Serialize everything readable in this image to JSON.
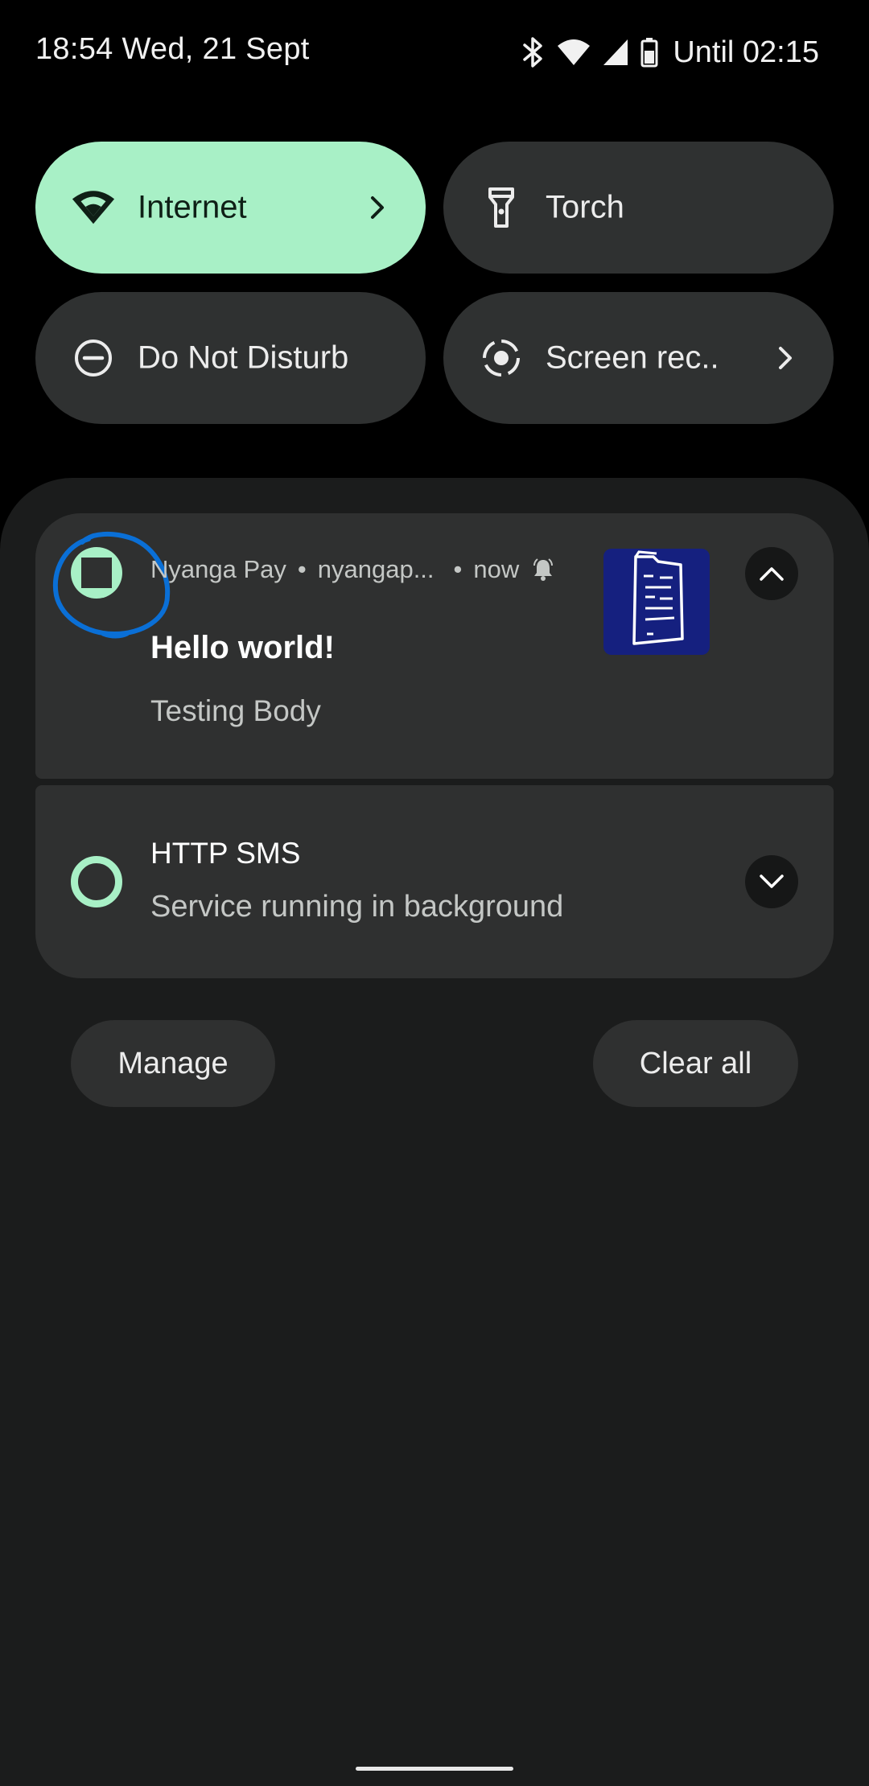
{
  "status_bar": {
    "time_date": "18:54 Wed, 21 Sept",
    "battery_text": "Until 02:15",
    "icons": [
      "bluetooth-icon",
      "wifi-icon",
      "cellular-signal-icon",
      "battery-icon"
    ]
  },
  "quick_tiles": [
    {
      "label": "Internet",
      "icon": "wifi-icon",
      "active": true,
      "has_chevron": true
    },
    {
      "label": "Torch",
      "icon": "flashlight-icon",
      "active": false,
      "has_chevron": false
    },
    {
      "label": "Do Not Disturb",
      "icon": "do-not-disturb-icon",
      "active": false,
      "has_chevron": false
    },
    {
      "label": "Screen rec..",
      "icon": "screen-record-icon",
      "active": false,
      "has_chevron": true
    }
  ],
  "notifications": [
    {
      "app_name": "Nyanga Pay",
      "channel": "nyangap...",
      "time": "now",
      "title": "Hello world!",
      "body": "Testing Body",
      "expanded": true,
      "thumbnail": "document-icon"
    },
    {
      "title": "HTTP SMS",
      "body": "Service running in background",
      "expanded": false
    }
  ],
  "actions": {
    "manage_label": "Manage",
    "clear_all_label": "Clear all"
  },
  "colors": {
    "accent": "#a8f0c6",
    "tile_off": "#2f3131",
    "shade_bg": "#1b1c1c",
    "card_bg": "#2f3030",
    "thumbnail_bg": "#15207f",
    "annotation": "#0a6fd6"
  }
}
